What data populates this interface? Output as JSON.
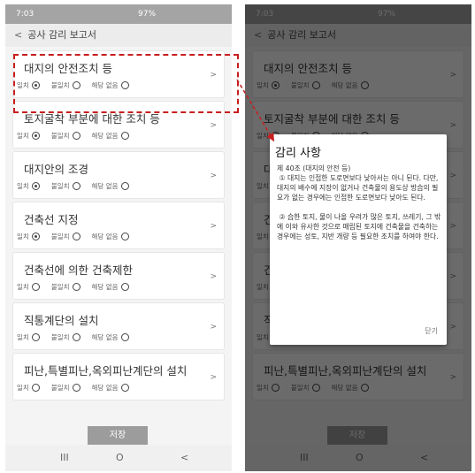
{
  "status": {
    "time": "7:03",
    "signal": "97%"
  },
  "appbar": {
    "back_glyph": "<",
    "title": "공사 감리 보고서"
  },
  "option_labels": {
    "match": "일치",
    "mismatch": "불일치",
    "na": "해당 없음"
  },
  "items": [
    {
      "title": "대지의 안전조치 등",
      "selected": "match"
    },
    {
      "title": "토지굴착 부분에 대한 조치 등",
      "selected": "match"
    },
    {
      "title": "대지안의 조경",
      "selected": "match"
    },
    {
      "title": "건축선 지정",
      "selected": "match"
    },
    {
      "title": "건축선에 의한 건축제한",
      "selected": "none"
    },
    {
      "title": "직통계단의 설치",
      "selected": "none"
    },
    {
      "title": "피난,특별피난,옥외피난계단의 설치",
      "selected": "none"
    }
  ],
  "save_label": "저장",
  "chevron_glyph": ">",
  "nav": {
    "recent": "III",
    "home": "O",
    "back": "<"
  },
  "dialog": {
    "title": "감리 사항",
    "body": "제 40조 (대지의 안전 등)\n ① 대지는 인접한 도로면보다 낮아서는 아니 된다. 다만, 대지의 배수에 지장이 없거나 건축물의 용도상 방습의 필요가 없는 경우에는 인접한 도로면보다 낮아도 된다.\n\n ② 습한 토지, 물이 나올 우려가 많은 토지, 쓰레기, 그 밖에 이와 유사한 것으로 매립된 토지에 건축물을 건축하는 경우에는 성토, 지반 개량 등 필요한 조치를 하여야 한다.",
    "close_label": "닫기"
  },
  "colors": {
    "highlight": "#c81e1e",
    "save_button": "#9c9c9c"
  }
}
